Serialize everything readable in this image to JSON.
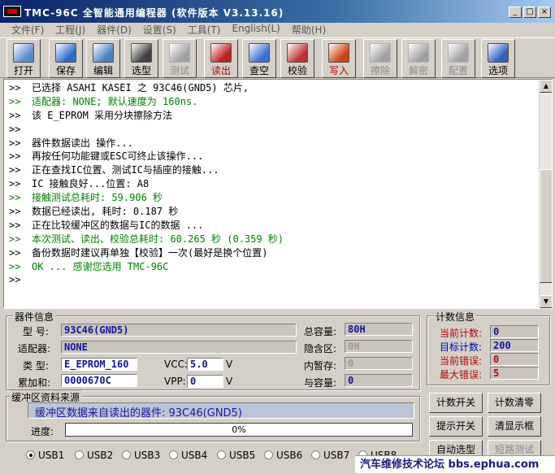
{
  "window": {
    "title": "TMC-96C 全智能通用编程器 (软件版本 V3.13.16)",
    "min": "_",
    "max": "□",
    "close": "×"
  },
  "menu": [
    "文件(F)",
    "工程(J)",
    "器件(D)",
    "设置(S)",
    "工具(T)",
    "English(L)",
    "帮助(H)"
  ],
  "toolbar": [
    {
      "label": "打开",
      "icon": "open-folder-icon",
      "color": "#5a8ad0"
    },
    {
      "label": "保存",
      "icon": "save-disk-icon",
      "color": "#2a6acc"
    },
    {
      "label": "编辑",
      "icon": "edit-pencil-icon",
      "color": "#4a80c0"
    },
    {
      "label": "选型",
      "icon": "chip-icon",
      "color": "#404040"
    },
    {
      "label": "测试",
      "icon": "test-icon",
      "color": "#a0a0a0"
    },
    {
      "label": "读出",
      "icon": "read-icon",
      "color": "#c02020"
    },
    {
      "label": "查空",
      "icon": "blank-check-icon",
      "color": "#3a70d0"
    },
    {
      "label": "校验",
      "icon": "verify-icon",
      "color": "#c03030"
    },
    {
      "label": "写入",
      "icon": "write-icon",
      "color": "#d04010"
    },
    {
      "label": "擦除",
      "icon": "erase-icon",
      "color": "#a0a0a0"
    },
    {
      "label": "解密",
      "icon": "decrypt-icon",
      "color": "#a0a0a0"
    },
    {
      "label": "配置",
      "icon": "config-icon",
      "color": "#a0a0a0"
    },
    {
      "label": "选项",
      "icon": "options-checklist-icon",
      "color": "#3060c0"
    }
  ],
  "log": [
    {
      "text": "已选择 ASAHI KASEI 之 93C46(GND5) 芯片,",
      "color": "black"
    },
    {
      "text": "适配器: NONE;  默认速度为 160ns.",
      "color": "green"
    },
    {
      "text": "该 E_EPROM 采用分块擦除方法",
      "color": "black"
    },
    {
      "text": "",
      "color": "black"
    },
    {
      "text": "器件数据读出 操作...",
      "color": "black"
    },
    {
      "text": "再按任何功能键或ESC可终止该操作...",
      "color": "black"
    },
    {
      "text": "正在查找IC位置、测试IC与插座的接触...",
      "color": "black"
    },
    {
      "text": "IC 接触良好...位置: A8",
      "color": "black"
    },
    {
      "text": "接触测试总耗时: 59.906 秒",
      "color": "green"
    },
    {
      "text": "数据已经读出, 耗时: 0.187 秒",
      "color": "black"
    },
    {
      "text": "正在比较缓冲区的数据与IC的数据 ...",
      "color": "black"
    },
    {
      "text": "本次测试、读出、校验总耗时: 60.265 秒 (0.359 秒)",
      "color": "green"
    },
    {
      "text": "备份数据时建议再单独【校验】一次(最好是换个位置)",
      "color": "black"
    },
    {
      "text": "OK ... 感谢您选用 TMC-96C",
      "color": "green"
    },
    {
      "text": "",
      "color": "black"
    }
  ],
  "log_prefix": ">>",
  "device": {
    "title": "器件信息",
    "model_label": "型  号:",
    "model": "93C46(GND5)",
    "adapter_label": "适配器:",
    "adapter": "NONE",
    "type_label": "类  型:",
    "type": "E_EPROM_160",
    "checksum_label": "累加和:",
    "checksum": "0000670C",
    "vcc_label": "VCC:",
    "vcc": "5.0",
    "vcc_unit": "V",
    "vpp_label": "VPP:",
    "vpp": "0",
    "vpp_unit": "V",
    "capacity_label": "总容量:",
    "capacity": "80H",
    "hidden_label": "隐含区:",
    "hidden": "0H",
    "temp_label": "内暂存:",
    "temp": "0",
    "and_label": "与容量:",
    "and": "0"
  },
  "buffer": {
    "title": "缓冲区资料来源",
    "source": "缓冲区数据来自读出的器件: 93C46(GND5)",
    "progress_label": "进度:",
    "progress_text": "0%",
    "progress": 0
  },
  "counts": {
    "title": "计数信息",
    "current_label": "当前计数:",
    "current": "0",
    "target_label": "目标计数:",
    "target": "200",
    "errors_label": "当前错误:",
    "errors": "0",
    "max_errors_label": "最大错误:",
    "max_errors": "5"
  },
  "buttons": {
    "count_toggle": "计数开关",
    "count_clear": "计数清零",
    "hint_toggle": "提示开关",
    "clear_display": "清显示框",
    "auto_select": "自动选型",
    "short_test": "短路测试"
  },
  "usb": {
    "options": [
      "USB1",
      "USB2",
      "USB3",
      "USB4",
      "USB5",
      "USB6",
      "USB7",
      "USB8"
    ],
    "selected": "USB1"
  },
  "watermark": "汽车维修技术论坛 bbs.ephua.com"
}
